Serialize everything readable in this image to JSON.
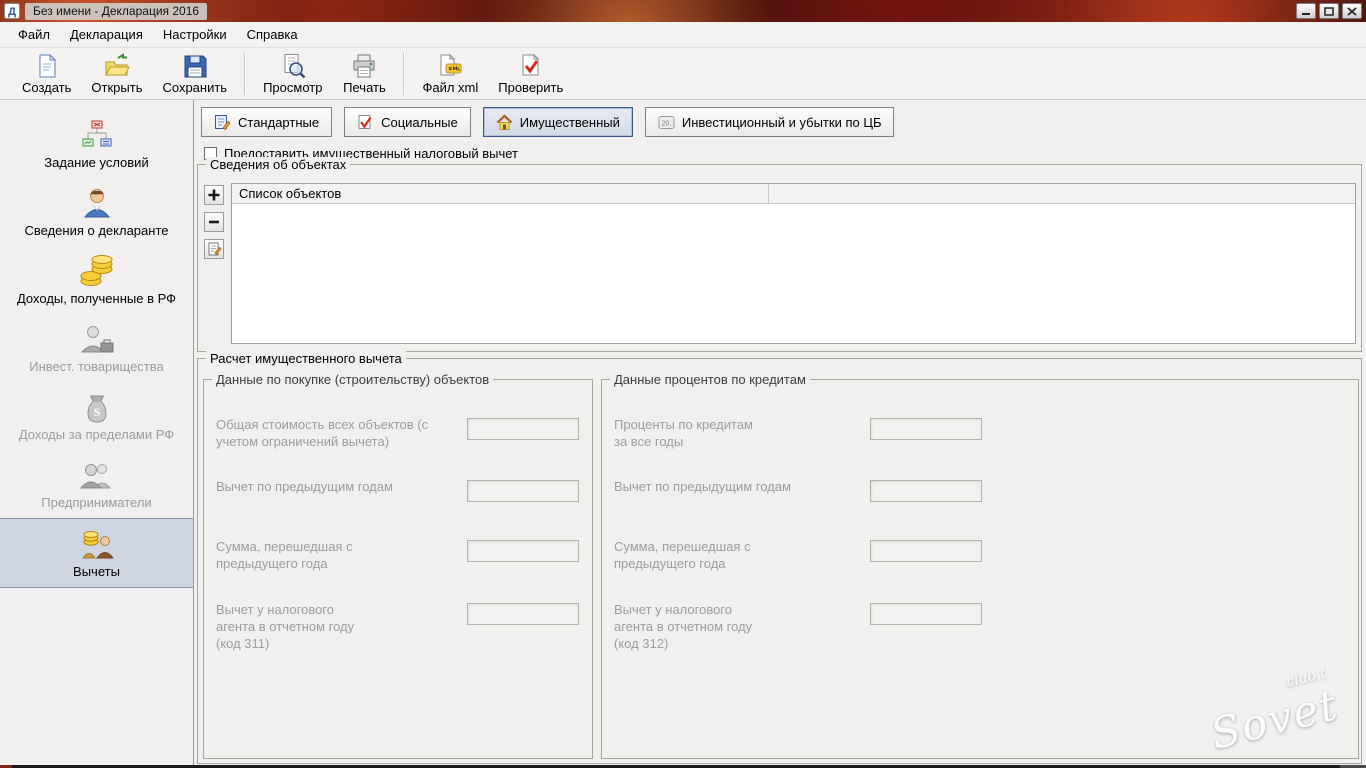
{
  "window": {
    "title": "Без имени - Декларация 2016"
  },
  "menu": {
    "items": [
      {
        "label": "Файл"
      },
      {
        "label": "Декларация"
      },
      {
        "label": "Настройки"
      },
      {
        "label": "Справка"
      }
    ]
  },
  "toolbar": {
    "buttons": [
      {
        "label": "Создать",
        "icon": "new-document-icon"
      },
      {
        "label": "Открыть",
        "icon": "open-folder-icon"
      },
      {
        "label": "Сохранить",
        "icon": "save-floppy-icon"
      },
      {
        "label": "Просмотр",
        "icon": "print-preview-icon"
      },
      {
        "label": "Печать",
        "icon": "printer-icon"
      },
      {
        "label": "Файл xml",
        "icon": "xml-file-icon"
      },
      {
        "label": "Проверить",
        "icon": "check-document-icon"
      }
    ]
  },
  "sidebar": {
    "items": [
      {
        "label": "Задание условий",
        "icon": "conditions-icon",
        "state": "enabled"
      },
      {
        "label": "Сведения о декларанте",
        "icon": "declarant-icon",
        "state": "enabled"
      },
      {
        "label": "Доходы, полученные в РФ",
        "icon": "coins-icon",
        "state": "enabled"
      },
      {
        "label": "Инвест. товарищества",
        "icon": "invest-partnership-icon",
        "state": "disabled"
      },
      {
        "label": "Доходы за пределами РФ",
        "icon": "money-bag-icon",
        "state": "disabled"
      },
      {
        "label": "Предприниматели",
        "icon": "entrepreneurs-icon",
        "state": "disabled"
      },
      {
        "label": "Вычеты",
        "icon": "deductions-icon",
        "state": "selected"
      }
    ]
  },
  "tabs": [
    {
      "label": "Стандартные",
      "icon": "standard-deductions-icon",
      "selected": false
    },
    {
      "label": "Социальные",
      "icon": "social-deductions-icon",
      "selected": false
    },
    {
      "label": "Имущественный",
      "icon": "property-house-icon",
      "selected": true
    },
    {
      "label": "Инвестиционный и убытки по ЦБ",
      "icon": "investment-percent-icon",
      "selected": false
    }
  ],
  "content": {
    "checkbox": {
      "label": "Предоставить имущественный налоговый вычет",
      "checked": false
    },
    "objects": {
      "title": "Сведения об объектах",
      "list_header": "Список объектов",
      "rows": []
    },
    "calc": {
      "title": "Расчет имущественного вычета",
      "purchase": {
        "title": "Данные по покупке (строительству) объектов",
        "fields": [
          {
            "label": "Общая стоимость всех объектов (с\nучетом ограничений вычета)",
            "value": ""
          },
          {
            "label": "Вычет по предыдущим годам",
            "value": ""
          },
          {
            "label": "Сумма, перешедшая с\nпредыдущего года",
            "value": ""
          },
          {
            "label": "Вычет у налогового\nагента в отчетном году\n(код 311)",
            "value": ""
          }
        ]
      },
      "credit": {
        "title": "Данные процентов по кредитам",
        "fields": [
          {
            "label": "Проценты по кредитам\nза все годы",
            "value": ""
          },
          {
            "label": "Вычет по предыдущим годам",
            "value": ""
          },
          {
            "label": "Сумма, перешедшая с\nпредыдущего года",
            "value": ""
          },
          {
            "label": "Вычет у налогового\nагента в отчетном году\n(код 312)",
            "value": ""
          }
        ]
      }
    }
  },
  "watermark": {
    "line1": "club.t",
    "line2": "Sovet"
  }
}
